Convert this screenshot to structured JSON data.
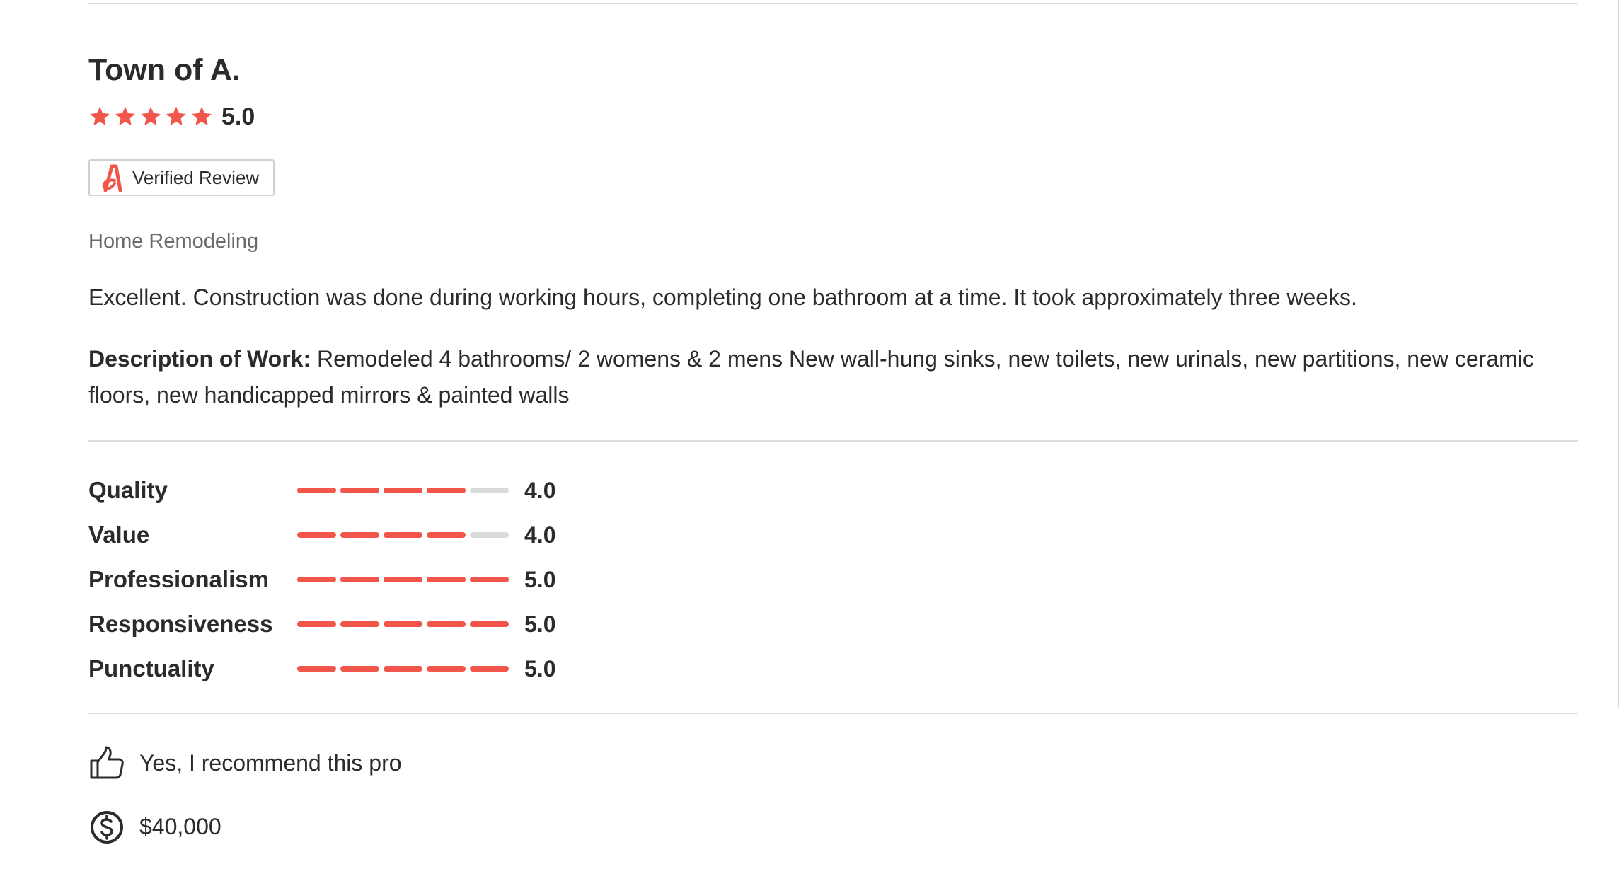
{
  "review": {
    "reviewer_name": "Town of A.",
    "rating": "5.0",
    "rating_stars": 5,
    "verified_label": "Verified Review",
    "category": "Home Remodeling",
    "text": "Excellent. Construction was done during working hours, completing one bathroom at a time. It took approximately three weeks.",
    "description_label": "Description of Work:",
    "description_text": "Remodeled 4 bathrooms/ 2 womens & 2 mens New wall-hung sinks, new toilets, new urinals, new partitions, new ceramic floors, new handicapped mirrors & painted walls"
  },
  "metrics": [
    {
      "label": "Quality",
      "value": "4.0",
      "score": 4
    },
    {
      "label": "Value",
      "value": "4.0",
      "score": 4
    },
    {
      "label": "Professionalism",
      "value": "5.0",
      "score": 5
    },
    {
      "label": "Responsiveness",
      "value": "5.0",
      "score": 5
    },
    {
      "label": "Punctuality",
      "value": "5.0",
      "score": 5
    }
  ],
  "recommend": {
    "icon": "thumbs-up-icon",
    "text": "Yes, I recommend this pro"
  },
  "cost": {
    "icon": "dollar-circle-icon",
    "text": "$40,000"
  },
  "colors": {
    "accent": "#f2554a",
    "bar_empty": "#dadada",
    "text": "#2b2b2b",
    "muted": "#6a6a6a",
    "divider": "#dcdcdc"
  }
}
